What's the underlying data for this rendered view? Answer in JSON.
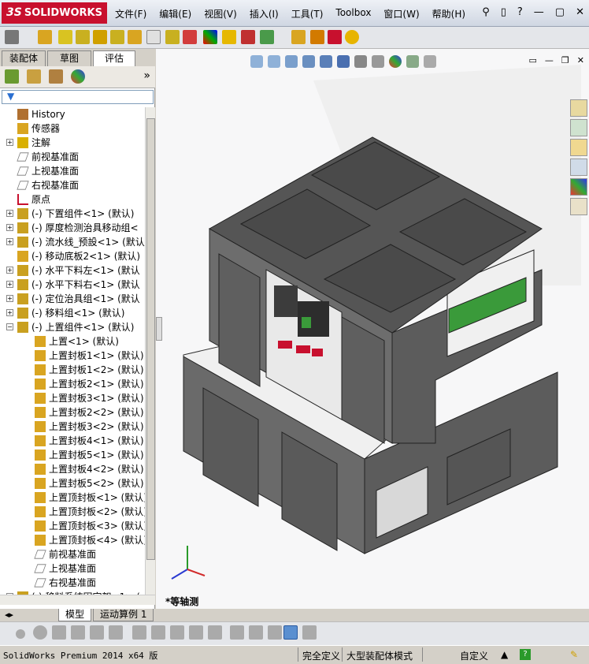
{
  "app": {
    "logo_text": "SOLIDWORKS",
    "logo_prefix": "3S"
  },
  "menu": [
    "文件(F)",
    "编辑(E)",
    "视图(V)",
    "插入(I)",
    "工具(T)",
    "Toolbox",
    "窗口(W)",
    "帮助(H)"
  ],
  "window_buttons": [
    "?",
    "—",
    "▢",
    "✕"
  ],
  "panel": {
    "tabs": [
      "装配体",
      "草图",
      "评估"
    ],
    "active_tab": 2,
    "expand_icon": "»",
    "tree": [
      {
        "label": "History",
        "indent": 1,
        "expander": "",
        "icon": "history-icon"
      },
      {
        "label": "传感器",
        "indent": 1,
        "expander": "",
        "icon": "sensor-icon"
      },
      {
        "label": "注解",
        "indent": 1,
        "expander": "+",
        "icon": "annotation-icon"
      },
      {
        "label": "前视基准面",
        "indent": 1,
        "expander": "",
        "icon": "plane-icon"
      },
      {
        "label": "上视基准面",
        "indent": 1,
        "expander": "",
        "icon": "plane-icon"
      },
      {
        "label": "右视基准面",
        "indent": 1,
        "expander": "",
        "icon": "plane-icon"
      },
      {
        "label": "原点",
        "indent": 1,
        "expander": "",
        "icon": "origin-icon"
      },
      {
        "label": "(-) 下置组件<1> (默认)",
        "indent": 1,
        "expander": "+",
        "icon": "assembly-icon"
      },
      {
        "label": "(-) 厚度检测治具移动组<",
        "indent": 1,
        "expander": "+",
        "icon": "assembly-icon"
      },
      {
        "label": "(-) 流水线_预設<1> (默认",
        "indent": 1,
        "expander": "+",
        "icon": "assembly-icon"
      },
      {
        "label": "(-) 移动底板2<1> (默认)",
        "indent": 1,
        "expander": "",
        "icon": "part-icon"
      },
      {
        "label": "(-) 水平下料左<1> (默认",
        "indent": 1,
        "expander": "+",
        "icon": "assembly-icon"
      },
      {
        "label": "(-) 水平下料右<1> (默认",
        "indent": 1,
        "expander": "+",
        "icon": "assembly-icon"
      },
      {
        "label": "(-) 定位治具组<1> (默认",
        "indent": 1,
        "expander": "+",
        "icon": "assembly-icon"
      },
      {
        "label": "(-) 移料组<1> (默认)",
        "indent": 1,
        "expander": "+",
        "icon": "assembly-icon"
      },
      {
        "label": "(-) 上置组件<1> (默认)",
        "indent": 1,
        "expander": "−",
        "icon": "assembly-icon"
      },
      {
        "label": "上置<1> (默认)",
        "indent": 2,
        "expander": "",
        "icon": "part-icon"
      },
      {
        "label": "上置封板1<1> (默认)",
        "indent": 2,
        "expander": "",
        "icon": "part-icon"
      },
      {
        "label": "上置封板1<2> (默认)",
        "indent": 2,
        "expander": "",
        "icon": "part-icon"
      },
      {
        "label": "上置封板2<1> (默认)",
        "indent": 2,
        "expander": "",
        "icon": "part-icon"
      },
      {
        "label": "上置封板3<1> (默认)",
        "indent": 2,
        "expander": "",
        "icon": "part-icon"
      },
      {
        "label": "上置封板2<2> (默认)",
        "indent": 2,
        "expander": "",
        "icon": "part-icon"
      },
      {
        "label": "上置封板3<2> (默认)",
        "indent": 2,
        "expander": "",
        "icon": "part-icon"
      },
      {
        "label": "上置封板4<1> (默认)",
        "indent": 2,
        "expander": "",
        "icon": "part-icon"
      },
      {
        "label": "上置封板5<1> (默认)",
        "indent": 2,
        "expander": "",
        "icon": "part-icon"
      },
      {
        "label": "上置封板4<2> (默认)",
        "indent": 2,
        "expander": "",
        "icon": "part-icon"
      },
      {
        "label": "上置封板5<2> (默认)",
        "indent": 2,
        "expander": "",
        "icon": "part-icon"
      },
      {
        "label": "上置顶封板<1> (默认)",
        "indent": 2,
        "expander": "",
        "icon": "part-icon"
      },
      {
        "label": "上置顶封板<2> (默认)",
        "indent": 2,
        "expander": "",
        "icon": "part-icon"
      },
      {
        "label": "上置顶封板<3> (默认)",
        "indent": 2,
        "expander": "",
        "icon": "part-icon"
      },
      {
        "label": "上置顶封板<4> (默认)",
        "indent": 2,
        "expander": "",
        "icon": "part-icon"
      },
      {
        "label": "前视基准面",
        "indent": 2,
        "expander": "",
        "icon": "plane-icon"
      },
      {
        "label": "上视基准面",
        "indent": 2,
        "expander": "",
        "icon": "plane-icon"
      },
      {
        "label": "右视基准面",
        "indent": 2,
        "expander": "",
        "icon": "plane-icon"
      },
      {
        "label": "(-) 移料系统固定架<1> (",
        "indent": 1,
        "expander": "+",
        "icon": "assembly-icon"
      }
    ]
  },
  "viewport": {
    "view_label": "*等轴测"
  },
  "bottom_tabs": [
    "模型",
    "运动算例 1"
  ],
  "status": {
    "product": "SolidWorks Premium 2014 x64 版",
    "state": "完全定义",
    "mode": "大型装配体模式",
    "units": "自定义",
    "help": "?"
  },
  "colors": {
    "machine": "#5f5f5f",
    "panel_top": "#4a4a4a",
    "frame_white": "#f2f2f2",
    "accent_red": "#c8102e",
    "accent_green": "#3a9a3a"
  }
}
